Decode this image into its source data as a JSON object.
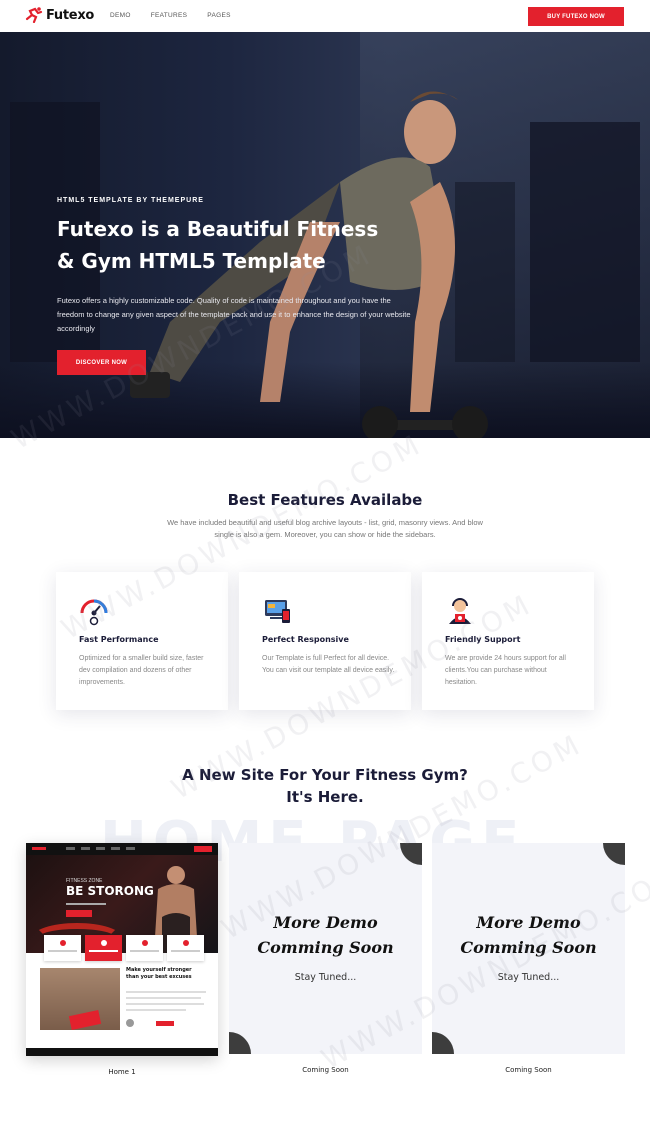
{
  "header": {
    "logo_text": "Futexo",
    "nav": [
      "DEMO",
      "FEATURES",
      "PAGES"
    ],
    "buy_label": "BUY FUTEXO NOW"
  },
  "hero": {
    "subtitle": "HTML5 TEMPLATE BY THEMEPURE",
    "title": "Futexo is a Beautiful Fitness & Gym HTML5 Template",
    "description": "Futexo offers a highly customizable code. Quality of code is maintained throughout and you have the freedom to change any given aspect of the template pack and use it to enhance the design of your website accordingly",
    "button_label": "DISCOVER NOW"
  },
  "features": {
    "title": "Best Features Availabe",
    "description": "We have included beautiful and useful blog archive layouts - list, grid, masonry views. And blow single is also a gem. Moreover, you can show or hide the sidebars.",
    "cards": [
      {
        "icon": "speedometer-icon",
        "title": "Fast Performance",
        "text": "Optimized for a smaller build size, faster dev compilation and dozens of other improvements."
      },
      {
        "icon": "responsive-devices-icon",
        "title": "Perfect Responsive",
        "text": "Our Template is full Perfect for all device. You can visit our template all device easily."
      },
      {
        "icon": "support-agent-icon",
        "title": "Friendly Support",
        "text": "We are provide 24 hours support for all clients.You can purchase without hesitation."
      }
    ]
  },
  "demos": {
    "title_line1": "A New Site For Your Fitness Gym?",
    "title_line2": "It's Here.",
    "background_text": "HOME PAGE",
    "home1": {
      "tag": "FITNESS ZONE",
      "headline": "BE STORONG",
      "section_heading": "Make yourself stronger than your best excuses",
      "label": "Home 1"
    },
    "coming": [
      {
        "title_line1": "More Demo",
        "title_line2": "Comming Soon",
        "subtitle": "Stay Tuned...",
        "label": "Coming Soon"
      },
      {
        "title_line1": "More Demo",
        "title_line2": "Comming Soon",
        "subtitle": "Stay Tuned...",
        "label": "Coming Soon"
      }
    ]
  },
  "watermark": "WWW.DOWNDEMO.COM",
  "colors": {
    "accent": "#e3212d",
    "heading": "#1b1c38"
  }
}
